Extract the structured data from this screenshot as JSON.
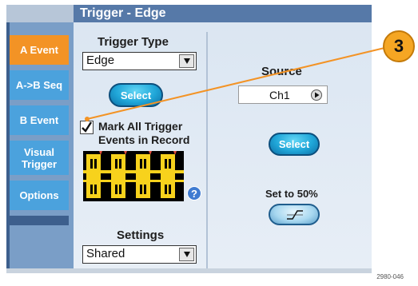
{
  "window": {
    "title": "Trigger - Edge"
  },
  "tabs": [
    {
      "label": "A Event",
      "active": true
    },
    {
      "label": "A->B Seq",
      "active": false
    },
    {
      "label": "B Event",
      "active": false
    },
    {
      "label": "Visual Trigger",
      "active": false
    },
    {
      "label": "Options",
      "active": false
    }
  ],
  "trigger_type": {
    "heading": "Trigger Type",
    "value": "Edge",
    "select_label": "Select"
  },
  "mark_all": {
    "checked": true,
    "label": "Mark All Trigger Events in Record"
  },
  "help_label": "?",
  "settings": {
    "heading": "Settings",
    "value": "Shared"
  },
  "source": {
    "heading": "Source",
    "value": "Ch1",
    "select_label": "Select"
  },
  "set_to_50": {
    "label": "Set to 50%"
  },
  "callout": {
    "number": "3"
  },
  "figure_code": "2980-046",
  "colors": {
    "accent_orange": "#f39325",
    "tab_blue": "#4ba2dd",
    "title_bar": "#5679a8",
    "waveform": "#f7d21c"
  },
  "icons": {
    "dropdown_arrow": "chevron-down-icon",
    "source_next": "play-icon",
    "slope": "rising-edge-icon",
    "help": "help-icon"
  }
}
